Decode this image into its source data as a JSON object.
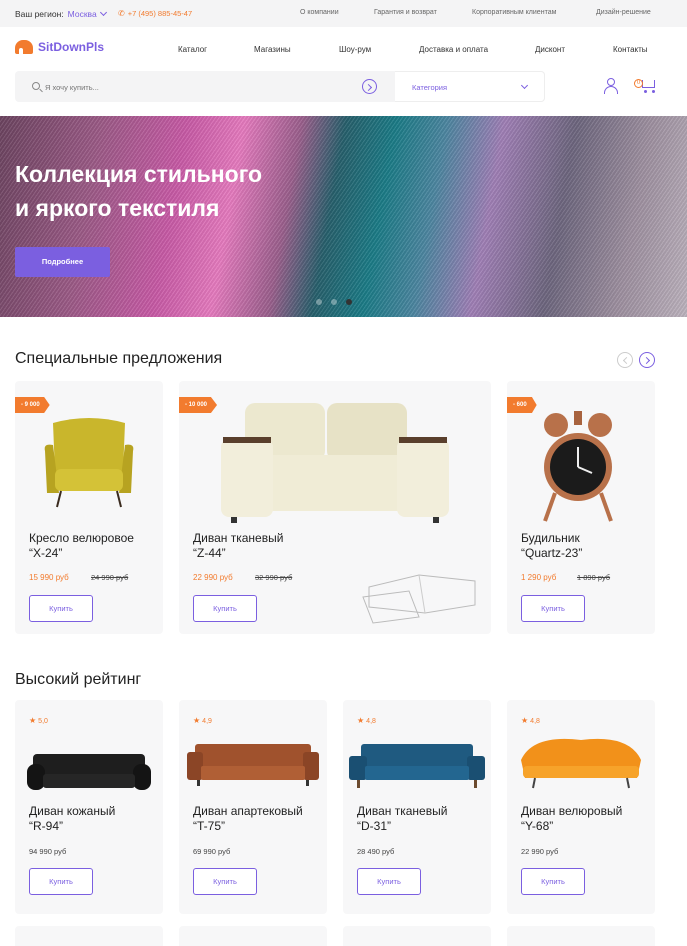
{
  "topbar": {
    "region_label": "Ваш регион:",
    "region_city": "Москва",
    "phone": "+7 (495) 885-45-47",
    "links": [
      "О компании",
      "Гарантия и возврат",
      "Корпоративным клиентам",
      "Дизайн-решение"
    ]
  },
  "header": {
    "logo": "SitDownPls",
    "nav": [
      "Каталог",
      "Магазины",
      "Шоу-рум",
      "Доставка и оплата",
      "Дисконт",
      "Контакты"
    ],
    "search_placeholder": "Я хочу купить...",
    "category_label": "Категория",
    "cart_count": "0"
  },
  "hero": {
    "title_line1": "Коллекция стильного",
    "title_line2": "и яркого текстиля",
    "button": "Подробнее",
    "slides_total": 3,
    "active_slide": 3
  },
  "special": {
    "title": "Специальные предложения",
    "items": [
      {
        "badge": "- 9 000",
        "name1": "Кресло велюровое",
        "name2": "“X-24”",
        "price": "15 990 руб",
        "old_price": "24 990 руб",
        "buy": "Купить"
      },
      {
        "badge": "- 10 000",
        "name1": "Диван тканевый",
        "name2": "“Z-44”",
        "price": "22 990 руб",
        "old_price": "32 990 руб",
        "buy": "Купить"
      },
      {
        "badge": "- 600",
        "name1": "Будильник",
        "name2": "“Quartz-23”",
        "price": "1 290 руб",
        "old_price": "1 890 руб",
        "buy": "Купить"
      }
    ]
  },
  "rating": {
    "title": "Высокий рейтинг",
    "items": [
      {
        "rating": "5,0",
        "name1": "Диван кожаный",
        "name2": "“R-94”",
        "price": "94 990 руб",
        "buy": "Купить"
      },
      {
        "rating": "4,9",
        "name1": "Диван апартековый",
        "name2": "“T-75”",
        "price": "69 990 руб",
        "buy": "Купить"
      },
      {
        "rating": "4,8",
        "name1": "Диван тканевый",
        "name2": "“D-31”",
        "price": "28 490 руб",
        "buy": "Купить"
      },
      {
        "rating": "4,8",
        "name1": "Диван велюровый",
        "name2": "“Y-68”",
        "price": "22 990 руб",
        "buy": "Купить"
      }
    ]
  },
  "colors": {
    "accent": "#7b5fe0",
    "orange": "#f27b2e"
  }
}
